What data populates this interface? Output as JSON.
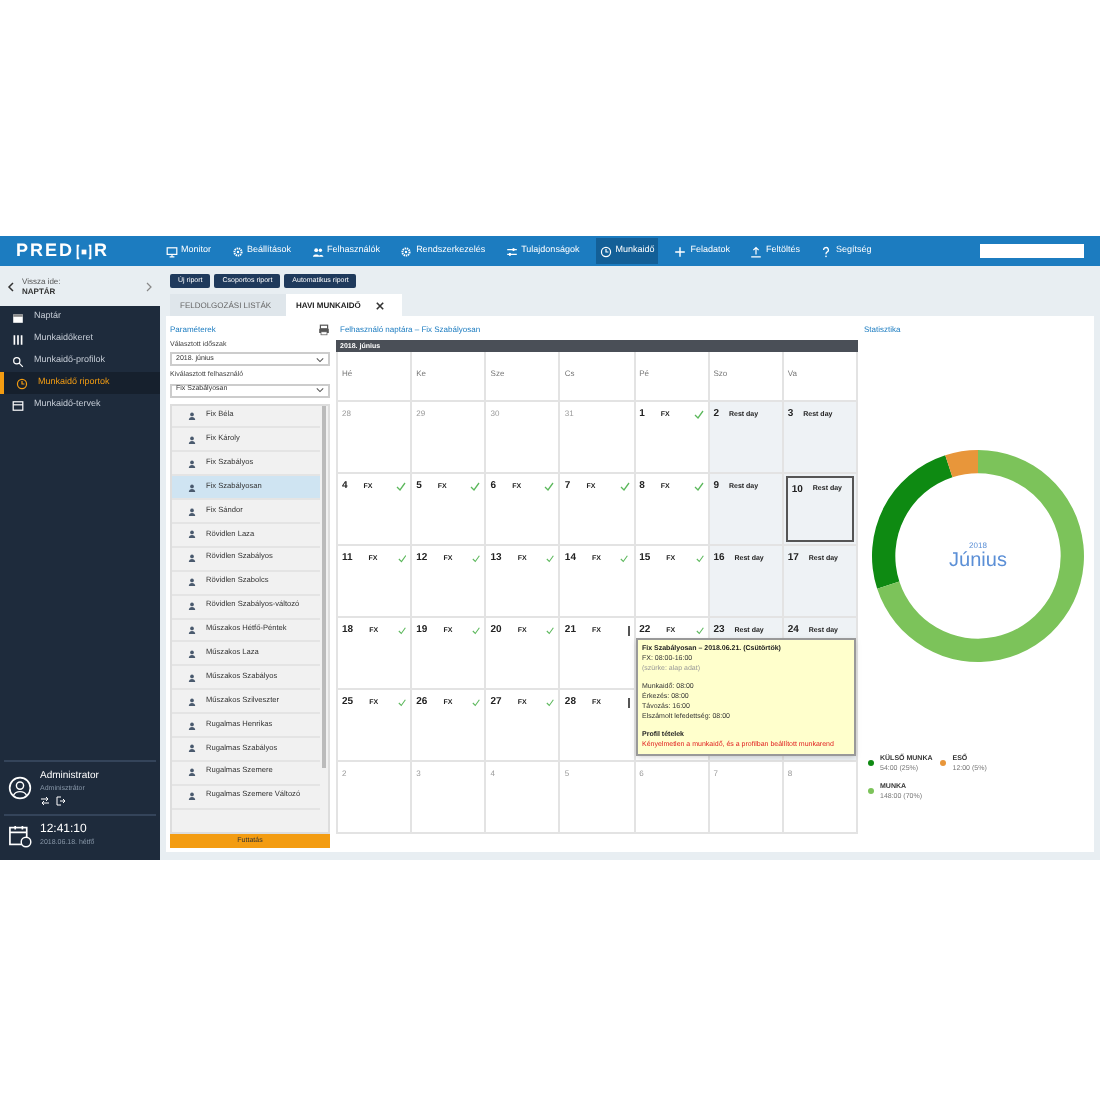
{
  "logo": {
    "left": "PRED",
    "right": "R"
  },
  "nav": [
    {
      "label": "Monitor",
      "selected": false
    },
    {
      "label": "Beállítások",
      "selected": false
    },
    {
      "label": "Felhasználók",
      "selected": false
    },
    {
      "label": "Rendszerkezelés",
      "selected": false
    },
    {
      "label": "Tulajdonságok",
      "selected": false
    },
    {
      "label": "Munkaidő",
      "selected": true
    },
    {
      "label": "Feladatok",
      "selected": false
    },
    {
      "label": "Feltöltés",
      "selected": false
    },
    {
      "label": "Segítség",
      "selected": false
    }
  ],
  "sidebar": {
    "back_label": "Vissza ide:",
    "back_target": "NAPTÁR",
    "items": [
      {
        "label": "Naptár",
        "selected": false
      },
      {
        "label": "Munkaidőkeret",
        "selected": false
      },
      {
        "label": "Munkaidő-profilok",
        "selected": false
      },
      {
        "label": "Munkaidő riportok",
        "selected": true
      },
      {
        "label": "Munkaidő-tervek",
        "selected": false
      }
    ],
    "user": {
      "name": "Administrator",
      "role": "Adminisztrátor"
    },
    "clock": {
      "time": "12:41:10",
      "date": "2018.06.18. hétfő"
    }
  },
  "actions": [
    "Új riport",
    "Csoportos riport",
    "Automatikus riport"
  ],
  "tabs": [
    {
      "label": "FELDOLGOZÁSI LISTÁK",
      "selected": false,
      "closable": false
    },
    {
      "label": "HAVI MUNKAIDŐ",
      "selected": true,
      "closable": true
    }
  ],
  "params": {
    "title": "Paraméterek",
    "period_label": "Választott időszak",
    "period": "2018. június",
    "user_label": "Kiválasztott felhasználó",
    "user": "Fix Szabályosan",
    "users": [
      {
        "name": "Fix Béla",
        "selected": false
      },
      {
        "name": "Fix Károly",
        "selected": false
      },
      {
        "name": "Fix Szabályos",
        "selected": false
      },
      {
        "name": "Fix Szabályosan",
        "selected": true
      },
      {
        "name": "Fix Sándor",
        "selected": false
      },
      {
        "name": "Rövidlen Laza",
        "selected": false
      },
      {
        "name": "Rövidlen Szabályos",
        "selected": false
      },
      {
        "name": "Rövidlen Szabolcs",
        "selected": false
      },
      {
        "name": "Rövidlen Szabályos-változó",
        "selected": false
      },
      {
        "name": "Műszakos Hétfő-Péntek",
        "selected": false
      },
      {
        "name": "Műszakos Laza",
        "selected": false
      },
      {
        "name": "Műszakos Szabályos",
        "selected": false
      },
      {
        "name": "Műszakos Szilveszter",
        "selected": false
      },
      {
        "name": "Rugalmas Henrikas",
        "selected": false
      },
      {
        "name": "Rugalmas Szabályos",
        "selected": false
      },
      {
        "name": "Rugalmas Szemere",
        "selected": false
      },
      {
        "name": "Rugalmas Szemere Változó",
        "selected": false
      }
    ],
    "run": "Futtatás"
  },
  "calendar": {
    "title": "Felhasználó naptára – Fix Szabályosan",
    "month": "2018. június",
    "weekdays": [
      "Hé",
      "Ke",
      "Sze",
      "Cs",
      "Pé",
      "Szo",
      "Va"
    ],
    "weeks": [
      [
        {
          "kind": "other",
          "day": "28"
        },
        {
          "kind": "other",
          "day": "29"
        },
        {
          "kind": "other",
          "day": "30"
        },
        {
          "kind": "other",
          "day": "31"
        },
        {
          "kind": "work",
          "day": "1",
          "shift": "FX",
          "ok": true
        },
        {
          "kind": "rest",
          "day": "2",
          "shift": "Rest day"
        },
        {
          "kind": "rest",
          "day": "3",
          "shift": "Rest day"
        }
      ],
      [
        {
          "kind": "work",
          "day": "4",
          "shift": "FX",
          "ok": true
        },
        {
          "kind": "work",
          "day": "5",
          "shift": "FX",
          "ok": true
        },
        {
          "kind": "work",
          "day": "6",
          "shift": "FX",
          "ok": true
        },
        {
          "kind": "work",
          "day": "7",
          "shift": "FX",
          "ok": true
        },
        {
          "kind": "work",
          "day": "8",
          "shift": "FX",
          "ok": true
        },
        {
          "kind": "rest",
          "day": "9",
          "shift": "Rest day"
        },
        {
          "kind": "rest",
          "day": "10",
          "shift": "Rest day",
          "selected": true
        }
      ],
      [
        {
          "kind": "work",
          "day": "11",
          "shift": "FX",
          "ok": true
        },
        {
          "kind": "work",
          "day": "12",
          "shift": "FX",
          "ok": true
        },
        {
          "kind": "work",
          "day": "13",
          "shift": "FX",
          "ok": true
        },
        {
          "kind": "work",
          "day": "14",
          "shift": "FX",
          "ok": true
        },
        {
          "kind": "work",
          "day": "15",
          "shift": "FX",
          "ok": true
        },
        {
          "kind": "rest",
          "day": "16",
          "shift": "Rest day"
        },
        {
          "kind": "rest",
          "day": "17",
          "shift": "Rest day"
        }
      ],
      [
        {
          "kind": "work",
          "day": "18",
          "shift": "FX",
          "ok": true
        },
        {
          "kind": "work",
          "day": "19",
          "shift": "FX",
          "ok": true
        },
        {
          "kind": "work",
          "day": "20",
          "shift": "FX",
          "ok": true
        },
        {
          "kind": "work",
          "day": "21",
          "shift": "FX",
          "ok": false
        },
        {
          "kind": "work",
          "day": "22",
          "shift": "FX",
          "ok": true
        },
        {
          "kind": "rest",
          "day": "23",
          "shift": "Rest day"
        },
        {
          "kind": "rest",
          "day": "24",
          "shift": "Rest day"
        }
      ],
      [
        {
          "kind": "work",
          "day": "25",
          "shift": "FX",
          "ok": true
        },
        {
          "kind": "work",
          "day": "26",
          "shift": "FX",
          "ok": true
        },
        {
          "kind": "work",
          "day": "27",
          "shift": "FX",
          "ok": true
        },
        {
          "kind": "work",
          "day": "28",
          "shift": "FX",
          "ok": false
        },
        {
          "kind": "hidden"
        },
        {
          "kind": "hidden"
        },
        {
          "kind": "hidden"
        }
      ],
      [
        {
          "kind": "other",
          "day": "2"
        },
        {
          "kind": "other",
          "day": "3"
        },
        {
          "kind": "other",
          "day": "4"
        },
        {
          "kind": "other",
          "day": "5"
        },
        {
          "kind": "other",
          "day": "6"
        },
        {
          "kind": "other",
          "day": "7"
        },
        {
          "kind": "other",
          "day": "8"
        }
      ]
    ],
    "tooltip": [
      {
        "kind": "title",
        "text": "Fix Szabályosan – 2018.06.21. (Csütörtök)"
      },
      {
        "kind": "line",
        "text": "FX: 08:00-16:00"
      },
      {
        "kind": "muted",
        "text": "(szürke: alap adat)"
      },
      {
        "kind": "gap"
      },
      {
        "kind": "line",
        "text": "Munkaidő: 08:00"
      },
      {
        "kind": "line",
        "text": "Érkezés: 08:00"
      },
      {
        "kind": "line",
        "text": "Távozás: 16:00"
      },
      {
        "kind": "line",
        "text": "Elszámolt lefedettség: 08:00"
      },
      {
        "kind": "gap"
      },
      {
        "kind": "title",
        "text": "Profil tételek"
      },
      {
        "kind": "error",
        "text": "Kényelmetlen a munkaidő, és a profilban beállított munkarend"
      }
    ]
  },
  "stats": {
    "title": "Statisztika",
    "year": "2018",
    "month": "Június",
    "chart_data": {
      "type": "donut",
      "categories": [
        "KÜLSŐ MUNKA",
        "ESŐ",
        "MUNKA"
      ],
      "values": [
        25,
        5,
        70
      ]
    },
    "legend": [
      {
        "value": "54:00 (25%)",
        "color": "#0e8a12"
      },
      {
        "value": "12:00 (5%)",
        "color": "#e8963a"
      },
      {
        "value": "148:00 (70%)",
        "color": "#7cc35a"
      }
    ]
  }
}
